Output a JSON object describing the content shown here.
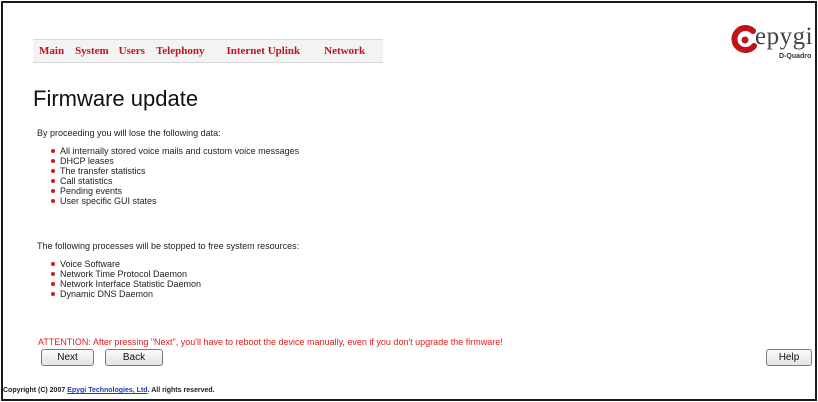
{
  "menu": {
    "items": [
      "Main",
      "System",
      "Users",
      "Telephony",
      "Internet Uplink",
      "Network"
    ]
  },
  "logo": {
    "wordmark": "epygi",
    "product": "D-Quadro",
    "mark_color": "#c0141b"
  },
  "page": {
    "title": "Firmware update"
  },
  "lose_section": {
    "intro": "By proceeding you will lose the following data:",
    "items": [
      "All internally stored voice mails and custom voice messages",
      "DHCP leases",
      "The transfer statistics",
      "Call statistics",
      "Pending events",
      "User specific GUI states"
    ]
  },
  "stop_section": {
    "intro": "The following processes will be stopped to free system resources:",
    "items": [
      "Voice Software",
      "Network Time Protocol Daemon",
      "Network Interface Statistic Daemon",
      "Dynamic DNS Daemon"
    ]
  },
  "attention": "ATTENTION: After pressing \"Next\", you'll have to reboot the device manually, even if you don't upgrade the firmware!",
  "buttons": {
    "next": "Next",
    "back": "Back",
    "help": "Help"
  },
  "footer": {
    "copyright_prefix": "Copyright (C) 2007 ",
    "company_link": "Epygi Technologies, Ltd",
    "copyright_suffix": ". All rights reserved."
  },
  "colors": {
    "accent_red": "#c0141b",
    "attention_red": "#e01b1b",
    "link_blue": "#1a3fb5"
  }
}
